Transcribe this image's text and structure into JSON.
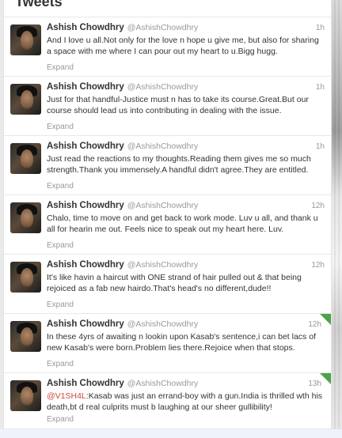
{
  "header": {
    "title": "Tweets"
  },
  "tweets": [
    {
      "name": "Ashish Chowdhry",
      "handle": "@AshishChowdhry",
      "time": "1h",
      "text": "And I love u all.Not only for the love n hope u give me, but also for sharing a space with me where I can pour out my heart to u.Bigg hugg.",
      "expand": "Expand",
      "highlighted": false
    },
    {
      "name": "Ashish Chowdhry",
      "handle": "@AshishChowdhry",
      "time": "1h",
      "text": "Just for that handful-Justice must n has to take its course.Great.But our course should lead us into contributing in dealing with the issue.",
      "expand": "Expand",
      "highlighted": false
    },
    {
      "name": "Ashish Chowdhry",
      "handle": "@AshishChowdhry",
      "time": "1h",
      "text": "Just read the reactions to my thoughts.Reading them gives me so much strength.Thank you immensely.A handful didn't agree.They are entitled.",
      "expand": "Expand",
      "highlighted": false
    },
    {
      "name": "Ashish Chowdhry",
      "handle": "@AshishChowdhry",
      "time": "12h",
      "text": "Chalo, time to move on and get back to work mode. Luv u all, and thank u all for hearin me out. Feels nice to speak out my heart here. Luv.",
      "expand": "Expand",
      "highlighted": false
    },
    {
      "name": "Ashish Chowdhry",
      "handle": "@AshishChowdhry",
      "time": "12h",
      "text": "It's like havin a haircut with ONE strand of hair pulled out & that being rejoiced as a fab new hairdo.That's head's no different,dude!!",
      "expand": "Expand",
      "highlighted": false
    },
    {
      "name": "Ashish Chowdhry",
      "handle": "@AshishChowdhry",
      "time": "12h",
      "text": "In these 4yrs of awaiting n lookin upon Kasab's sentence,i can bet lacs of new Kasab's were born.Problem lies there.Rejoice when that stops.",
      "expand": "Expand",
      "highlighted": true
    },
    {
      "name": "Ashish Chowdhry",
      "handle": "@AshishChowdhry",
      "time": "13h",
      "mention": "@V1SH4L",
      "text": ":Kasab was just an errand-boy with a gun.India is thrilled wth his death,bt d real culprits must b laughing at our sheer gullibility!",
      "expand": "Expand",
      "highlighted": true
    }
  ],
  "colors": {
    "accent": "#4ea34a",
    "mention": "#d0463c",
    "text": "#333333",
    "muted": "#999999"
  },
  "icons": {
    "retweet_flag": "retweet-flag-icon"
  }
}
